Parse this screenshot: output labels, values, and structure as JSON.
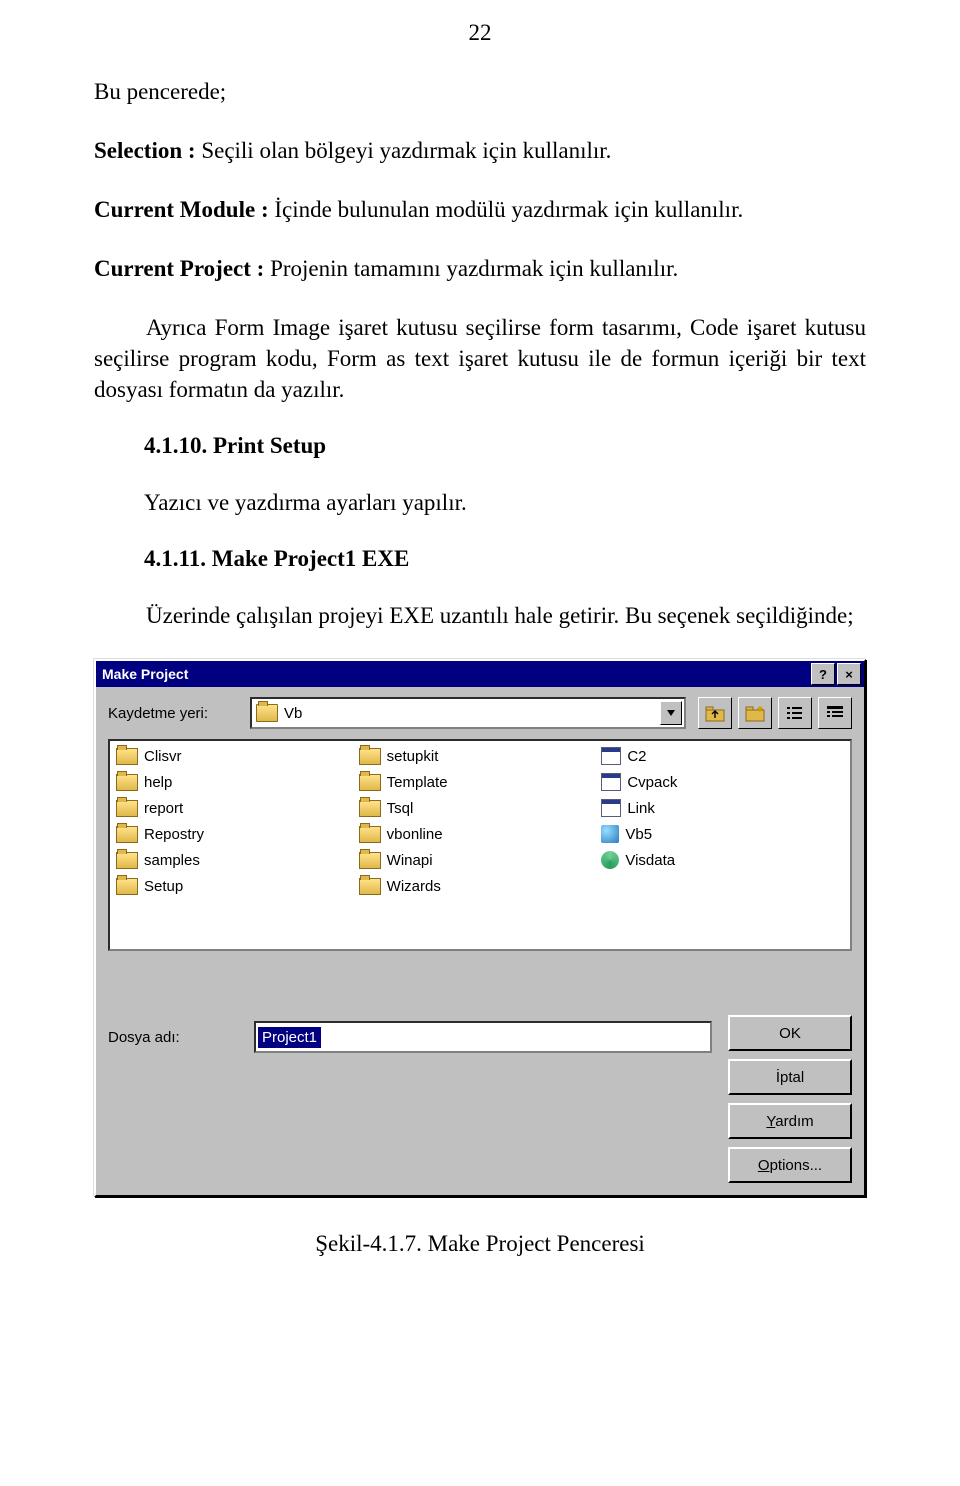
{
  "page_number": "22",
  "paragraphs": {
    "p1": "Bu pencerede;",
    "selection_label": "Selection :",
    "selection_text": " Seçili olan bölgeyi yazdırmak için kullanılır.",
    "current_module_label": "Current Module :",
    "current_module_text": " İçinde bulunulan modülü yazdırmak için kullanılır.",
    "current_project_label": "Current Project :",
    "current_project_text": " Projenin tamamını yazdırmak için kullanılır.",
    "form_image": "Ayrıca Form Image işaret kutusu seçilirse form tasarımı, Code işaret kutusu seçilirse program kodu, Form as text işaret kutusu ile de formun içeriği bir text dosyası formatın da yazılır.",
    "sec_4110": "4.1.10. Print Setup",
    "print_setup_desc": "Yazıcı ve yazdırma ayarları yapılır.",
    "sec_4111": "4.1.11. Make Project1 EXE",
    "exe_desc": "Üzerinde çalışılan projeyi EXE uzantılı hale getirir. Bu seçenek seçildiğinde;"
  },
  "dialog": {
    "title": "Make Project",
    "help_btn": "?",
    "close_btn": "×",
    "save_in_label": "Kaydetme yeri:",
    "save_in_value": "Vb",
    "file_name_label": "Dosya adı:",
    "file_name_value": "Project1",
    "buttons": {
      "ok": "OK",
      "cancel": "İptal",
      "help_prefix": "Y",
      "help_rest": "ardım",
      "options_prefix": "O",
      "options_rest": "ptions..."
    },
    "columns": [
      [
        {
          "icon": "folder",
          "label": "Clisvr"
        },
        {
          "icon": "folder",
          "label": "help"
        },
        {
          "icon": "folder",
          "label": "report"
        },
        {
          "icon": "folder",
          "label": "Repostry"
        },
        {
          "icon": "folder",
          "label": "samples"
        },
        {
          "icon": "folder",
          "label": "Setup"
        }
      ],
      [
        {
          "icon": "folder",
          "label": "setupkit"
        },
        {
          "icon": "folder",
          "label": "Template"
        },
        {
          "icon": "folder",
          "label": "Tsql"
        },
        {
          "icon": "folder",
          "label": "vbonline"
        },
        {
          "icon": "folder",
          "label": "Winapi"
        },
        {
          "icon": "folder",
          "label": "Wizards"
        }
      ],
      [
        {
          "icon": "exe",
          "label": "C2"
        },
        {
          "icon": "exe",
          "label": "Cvpack"
        },
        {
          "icon": "exe",
          "label": "Link"
        },
        {
          "icon": "vb",
          "label": "Vb5"
        },
        {
          "icon": "vis",
          "label": "Visdata"
        }
      ]
    ]
  },
  "caption": "Şekil-4.1.7. Make Project Penceresi"
}
